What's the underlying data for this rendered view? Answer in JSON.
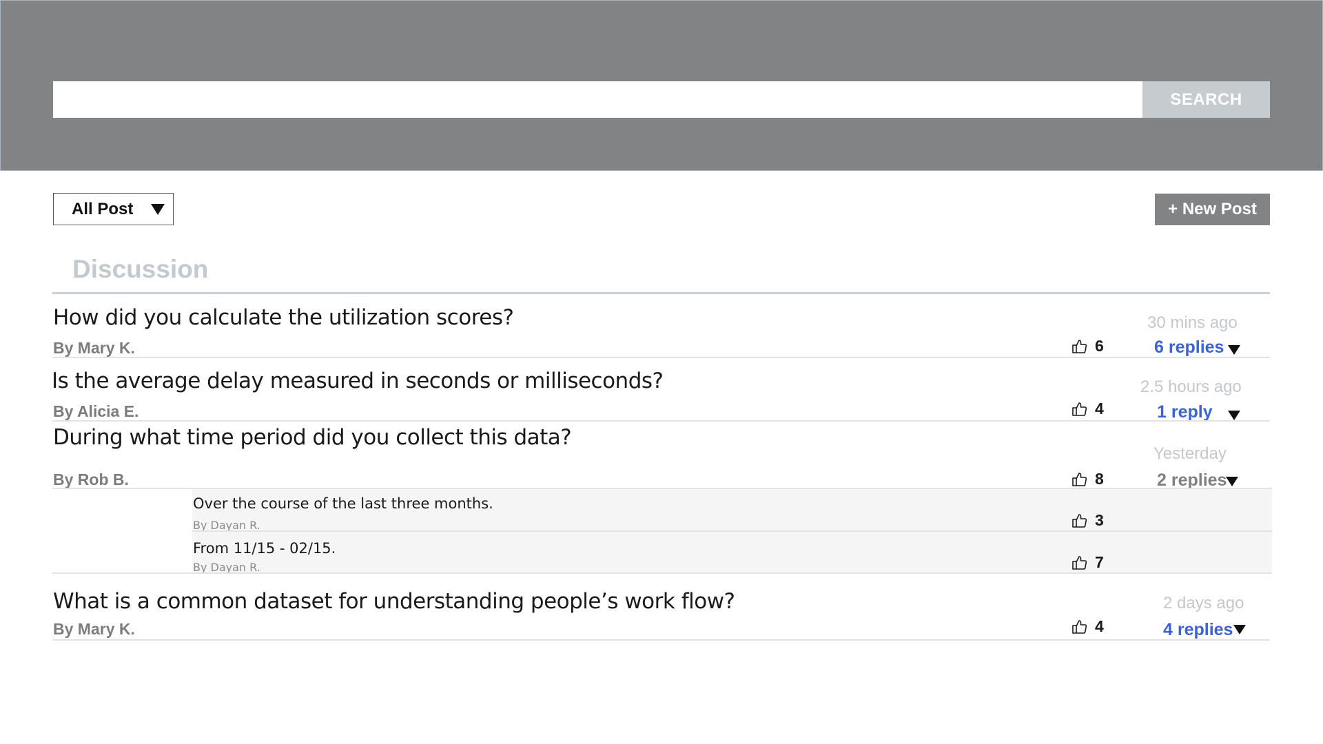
{
  "search": {
    "placeholder": "",
    "button_label": "SEARCH"
  },
  "toolbar": {
    "filter_label": "All Post",
    "new_post_label": "+ New Post"
  },
  "section": {
    "title": "Discussion"
  },
  "colors": {
    "header_bg": "#818385",
    "link_blue": "#3b63d3",
    "muted": "#c4c8cc"
  },
  "posts": [
    {
      "title": "How did you calculate the utilization scores?",
      "author": "By Mary K.",
      "likes": "6",
      "time": "30 mins ago",
      "replies": "6 replies"
    },
    {
      "title": "Is the average delay measured in seconds or milliseconds?",
      "author": "By Alicia E.",
      "likes": "4",
      "time": "2.5 hours ago",
      "replies": "1 reply"
    },
    {
      "title": "During what time period did you collect this data?",
      "author": "By Rob B.",
      "likes": "8",
      "time": "Yesterday",
      "replies": "2 replies",
      "reply_items": [
        {
          "text": "Over the course of the last three months.",
          "author": "By Dayan R.",
          "likes": "3"
        },
        {
          "text": "From 11/15 - 02/15.",
          "author": "By Dayan R.",
          "likes": "7"
        }
      ]
    },
    {
      "title": "What is a common dataset for understanding people’s work flow?",
      "author": "By Mary K.",
      "likes": "4",
      "time": "2 days ago",
      "replies": "4 replies"
    }
  ],
  "icons": {
    "like": "thumbs-up-icon",
    "expand": "caret-down-icon"
  }
}
